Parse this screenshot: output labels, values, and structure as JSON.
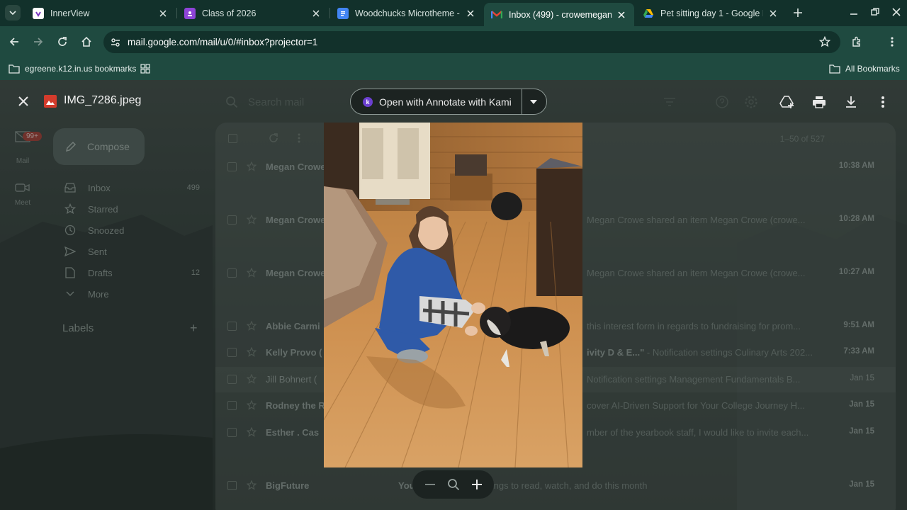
{
  "tabs": [
    {
      "title": "InnerView",
      "favicon": "innerview-icon",
      "color": "#ffffff"
    },
    {
      "title": "Class of 2026",
      "favicon": "classroom-icon",
      "color": "#8e44d8"
    },
    {
      "title": "Woodchucks Microtheme - Go",
      "favicon": "google-docs-icon",
      "color": "#4285f4"
    },
    {
      "title": "Inbox (499) - crowemegan@s",
      "favicon": "gmail-icon",
      "color": "#ea4335",
      "active": true
    },
    {
      "title": "Pet sitting day 1 - Google Driv",
      "favicon": "google-drive-icon",
      "color": "#34a853"
    }
  ],
  "address_bar": {
    "url": "mail.google.com/mail/u/0/#inbox?projector=1"
  },
  "bookmarks": {
    "left": "egreene.k12.in.us bookmarks",
    "right": "All Bookmarks"
  },
  "gmail": {
    "compose": "Compose",
    "search_placeholder": "Search mail",
    "badge": "99+",
    "rail": [
      "Mail",
      "Meet"
    ],
    "nav": [
      {
        "label": "Inbox",
        "count": "499"
      },
      {
        "label": "Starred",
        "count": ""
      },
      {
        "label": "Snoozed",
        "count": ""
      },
      {
        "label": "Sent",
        "count": ""
      },
      {
        "label": "Drafts",
        "count": "12"
      },
      {
        "label": "More",
        "count": ""
      }
    ],
    "labels_title": "Labels",
    "range": "1–50 of 527",
    "rows": [
      {
        "sender": "Megan Crowe",
        "subject": "",
        "snippet": "",
        "time": "10:38 AM",
        "read": false
      },
      {
        "sender": "Megan Crowe",
        "subject": "",
        "snippet": "Megan Crowe shared an item Megan Crowe (crowe...",
        "time": "10:28 AM",
        "read": false
      },
      {
        "sender": "Megan Crowe",
        "subject": "",
        "snippet": "Megan Crowe shared an item Megan Crowe (crowe...",
        "time": "10:27 AM",
        "read": false
      },
      {
        "sender": "Abbie Carmi",
        "subject": "",
        "snippet": "this interest form in regards to fundraising for prom...",
        "time": "9:51 AM",
        "read": false
      },
      {
        "sender": "Kelly Provo (",
        "subject": "ivity D & E...\"",
        "snippet": " - Notification settings Culinary Arts 202...",
        "time": "7:33 AM",
        "read": false
      },
      {
        "sender": "Jill Bohnert (",
        "subject": "",
        "snippet": "Notification settings Management Fundamentals B...",
        "time": "Jan 15",
        "read": true
      },
      {
        "sender": "Rodney the R",
        "subject": "",
        "snippet": "cover AI-Driven Support for Your College Journey H...",
        "time": "Jan 15",
        "read": false
      },
      {
        "sender": "Esther . Cas",
        "subject": "",
        "snippet": "mber of the yearbook staff, I would like to invite each...",
        "time": "Jan 15",
        "read": false
      },
      {
        "sender": "BigFuture",
        "subject": "Your ... m Is Here",
        "snippet": " - Things to read, watch, and do this month",
        "time": "Jan 15",
        "read": false
      }
    ]
  },
  "viewer": {
    "filename": "IMG_7286.jpeg",
    "open_with": "Open with Annotate with Kami",
    "kami_letter": "k"
  }
}
